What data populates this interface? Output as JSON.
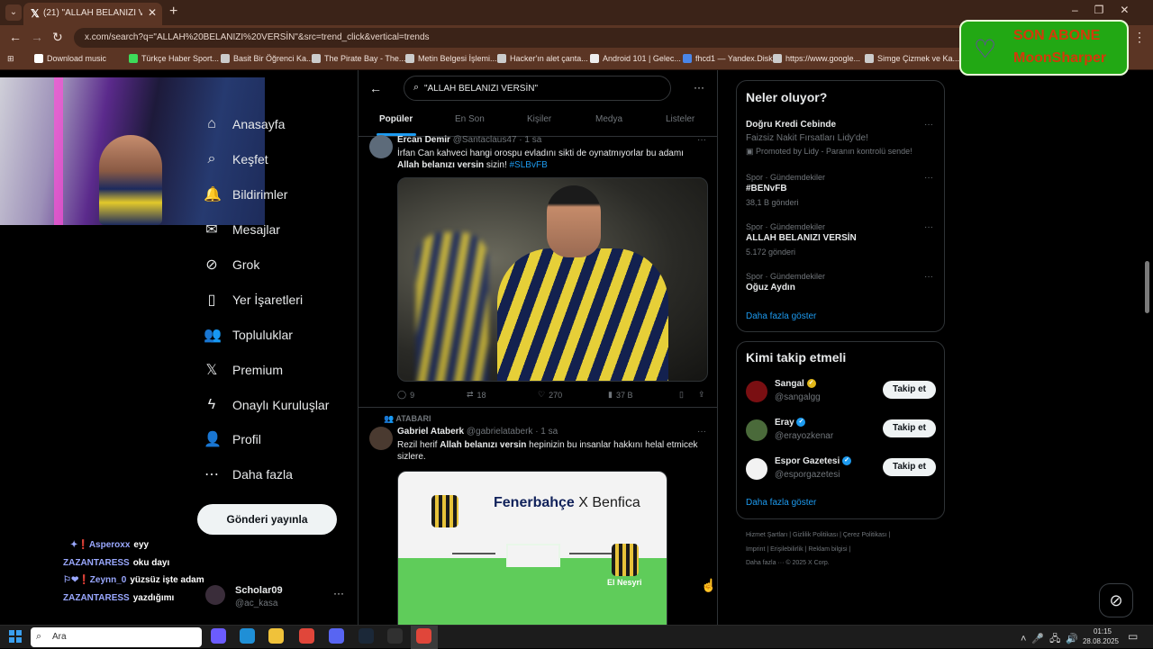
{
  "browser": {
    "tab_title": "(21) \"ALLAH BELANIZI VERSİN\"",
    "tab_logo": "𝕏",
    "tab_close": "✕",
    "new_tab": "+",
    "url": "x.com/search?q=\"ALLAH%20BELANIZI%20VERSİN\"&src=trend_click&vertical=trends",
    "bookmarks": [
      {
        "label": "Download music",
        "color": "#ffffff"
      },
      {
        "label": "Türkçe Haber Sport...",
        "color": "#3ddc5a"
      },
      {
        "label": "Basit Bir Öğrenci Ka...",
        "color": "#cccccc"
      },
      {
        "label": "The Pirate Bay - The...",
        "color": "#cccccc"
      },
      {
        "label": "Metin Belgesi İşlemi...",
        "color": "#cccccc"
      },
      {
        "label": "Hacker'ın alet çanta...",
        "color": "#cccccc"
      },
      {
        "label": "Android 101 | Gelec...",
        "color": "#eeeeee"
      },
      {
        "label": "fhcd1 — Yandex.Disk",
        "color": "#4a86e8"
      },
      {
        "label": "https://www.google...",
        "color": "#cccccc"
      },
      {
        "label": "Simge Çizmek ve Ka...",
        "color": "#cccccc"
      }
    ]
  },
  "sidebar": {
    "items": [
      {
        "label": "Anasayfa",
        "icon": "⌂",
        "icon_name": "home-icon"
      },
      {
        "label": "Keşfet",
        "icon": "⌕",
        "icon_name": "explore-icon"
      },
      {
        "label": "Bildirimler",
        "icon": "🔔",
        "icon_name": "bell-icon"
      },
      {
        "label": "Mesajlar",
        "icon": "✉",
        "icon_name": "mail-icon"
      },
      {
        "label": "Grok",
        "icon": "⊘",
        "icon_name": "grok-icon"
      },
      {
        "label": "Yer İşaretleri",
        "icon": "▯",
        "icon_name": "bookmark-icon"
      },
      {
        "label": "Topluluklar",
        "icon": "👥",
        "icon_name": "communities-icon"
      },
      {
        "label": "Premium",
        "icon": "𝕏",
        "icon_name": "premium-icon"
      },
      {
        "label": "Onaylı Kuruluşlar",
        "icon": "ϟ",
        "icon_name": "lightning-icon"
      },
      {
        "label": "Profil",
        "icon": "👤",
        "icon_name": "profile-icon"
      },
      {
        "label": "Daha fazla",
        "icon": "⋯",
        "icon_name": "more-icon"
      }
    ],
    "post_button": "Gönderi yayınla",
    "account_name": "Scholar09",
    "account_handle": "@ac_kasa",
    "account_more": "···"
  },
  "chat": [
    {
      "user": "✦❗Asperoxx",
      "msg": "eyy"
    },
    {
      "user": "ZAZANTARESS",
      "msg": "oku dayı"
    },
    {
      "user": "⚐❤❗Zeynn_0",
      "msg": "yüzsüz işte adam"
    },
    {
      "user": "ZAZANTARESS",
      "msg": "yazdığımı"
    }
  ],
  "search": {
    "value": "\"ALLAH BELANIZI VERSİN\"",
    "back": "←",
    "more": "···",
    "tabs": [
      "Popüler",
      "En Son",
      "Kişiler",
      "Medya",
      "Listeler"
    ]
  },
  "tweets": [
    {
      "name": "Ercan Demir",
      "handle": "@Santaclaus47",
      "time": "· 1 sa",
      "more": "···",
      "text_pre": "İrfan Can kahveci hangi orospu evladını sikti de oynatmıyorlar bu adamı ",
      "text_bold": "Allah belanızı versin",
      "text_post": " sizin! ",
      "hashtag": "#SLBvFB",
      "replies": "9",
      "retweets": "18",
      "likes": "270",
      "views": "37 B"
    },
    {
      "context": "ATABARI",
      "name": "Gabriel Ataberk",
      "handle": "@gabrielataberk",
      "time": "· 1 sa",
      "more": "···",
      "text_pre": "Rezil herif ",
      "text_bold": "Allah belanızı versin",
      "text_post": " hepinizin bu insanlar hakkını helal etmicek sizlere.",
      "media_title_bold": "Fenerbahçe",
      "media_title_rest": " X Benfica",
      "media_player_label": "El Nesyri"
    }
  ],
  "trends": {
    "title": "Neler oluyor?",
    "promo": {
      "title": "Doğru Kredi Cebinde",
      "subtitle": "Faizsiz Nakit Fırsatları Lidy'de!",
      "promoted": "Promoted by Lidy - Paranın kontrolü sende!"
    },
    "items": [
      {
        "category": "Spor · Gündemdekiler",
        "name": "#BENvFB",
        "count": "38,1 B gönderi"
      },
      {
        "category": "Spor · Gündemdekiler",
        "name": "ALLAH BELANIZI VERSİN",
        "count": "5.172 gönderi"
      },
      {
        "category": "Spor · Gündemdekiler",
        "name": "Oğuz Aydın",
        "count": ""
      }
    ],
    "show_more": "Daha fazla göster",
    "dots": "···"
  },
  "follow": {
    "title": "Kimi takip etmeli",
    "items": [
      {
        "name": "Sangal",
        "handle": "@sangalgg",
        "button": "Takip et",
        "color": "#7a0f12"
      },
      {
        "name": "Eray",
        "handle": "@erayozkenar",
        "button": "Takip et",
        "color": "#4a6a3a"
      },
      {
        "name": "Espor Gazetesi",
        "handle": "@esporgazetesi",
        "button": "Takip et",
        "color": "#f2f2f2"
      }
    ],
    "show_more": "Daha fazla göster"
  },
  "footer": {
    "line1": "Hizmet Şartları  |  Gizlilik Politikası  |  Çerez Politikası  |",
    "line2": "Imprint  |  Erişilebilirlik  |  Reklam bilgisi  |",
    "line3": "Daha fazla ···    © 2025 X Corp."
  },
  "sub_badge": {
    "line1": "SON ABONE",
    "line2": "MoonSharper",
    "icon": "♡"
  },
  "taskbar": {
    "search_placeholder": "Ara",
    "time": "01:15",
    "date": "28.08.2025",
    "icons": [
      {
        "name": "copilot-icon",
        "color": "#6b5cff"
      },
      {
        "name": "edge-icon",
        "color": "#1f8fd6"
      },
      {
        "name": "explorer-icon",
        "color": "#f0c23a"
      },
      {
        "name": "chrome-icon",
        "color": "#e0463a"
      },
      {
        "name": "discord-icon",
        "color": "#5865f2"
      },
      {
        "name": "steam-icon",
        "color": "#1b2838"
      },
      {
        "name": "obs-icon",
        "color": "#303030"
      },
      {
        "name": "chrome-active-icon",
        "color": "#e0463a"
      }
    ]
  }
}
